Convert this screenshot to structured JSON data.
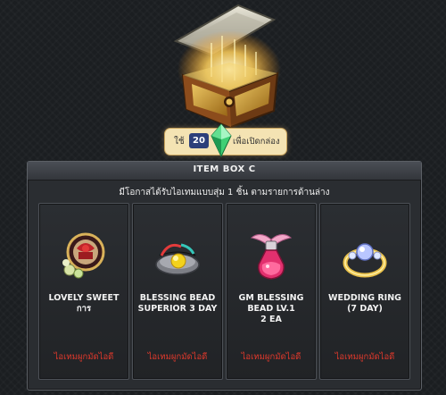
{
  "cost": {
    "use_label": "ใช้",
    "quantity": "20",
    "gem_icon": "green-crystal-icon",
    "open_label": "เพื่อเปิดกล่อง"
  },
  "panel": {
    "title": "ITEM BOX C",
    "description": "มีโอกาสได้รับไอเทมแบบสุ่ม 1 ชิ้น ตามรายการด้านล่าง"
  },
  "items": [
    {
      "name": "LOVELY SWEET\nการ",
      "icon": "lovely-sweet-icon",
      "tag": "ไอเทมผูกมัดไอดี"
    },
    {
      "name": "BLESSING BEAD\nSUPERIOR 3 DAY",
      "icon": "blessing-bead-icon",
      "tag": "ไอเทมผูกมัดไอดี"
    },
    {
      "name": "GM BLESSING\nBEAD LV.1\n2 EA",
      "icon": "gm-blessing-bead-icon",
      "tag": "ไอเทมผูกมัดไอดี"
    },
    {
      "name": "WEDDING RING\n(7 DAY)",
      "icon": "wedding-ring-icon",
      "tag": "ไอเทมผูกมัดไอดี"
    }
  ],
  "colors": {
    "background": "#1b1e21",
    "panel": "#2a2d31",
    "tag_red": "#e0392c",
    "pill": "#f4e3b3",
    "qty_badge": "#2d3f7a"
  }
}
